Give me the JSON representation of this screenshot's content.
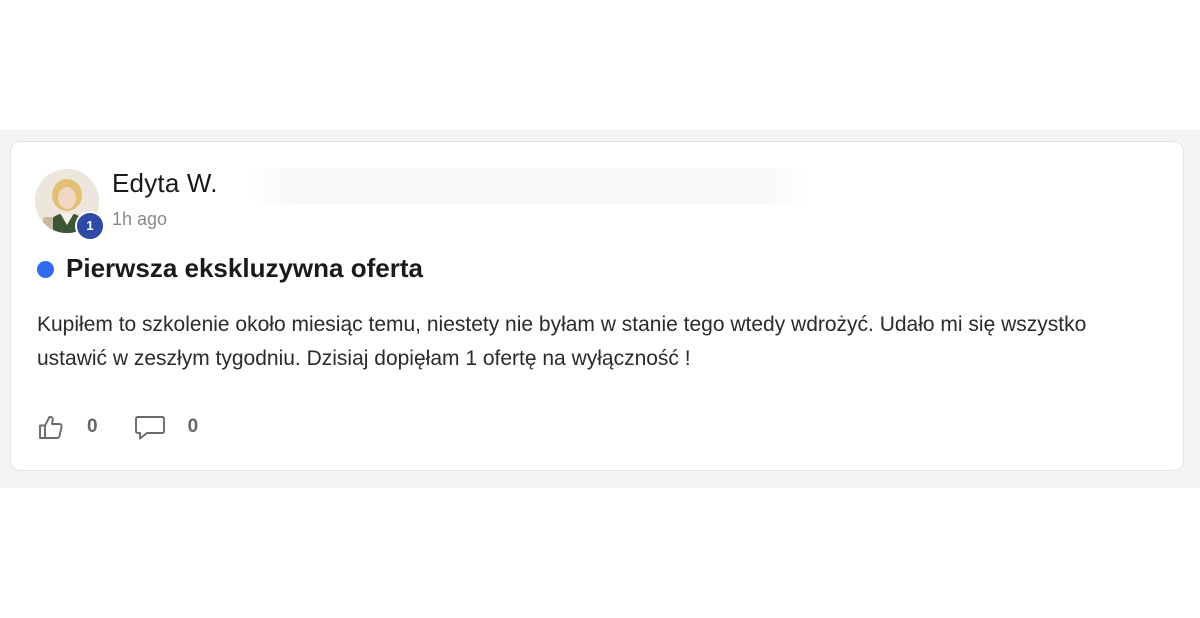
{
  "post": {
    "author": {
      "name": "Edyta W.",
      "level": "1",
      "avatar_icon": "user-photo"
    },
    "time": "1h ago",
    "title": "Pierwsza ekskluzywna oferta",
    "title_dot_color": "#2f6cf2",
    "body": "Kupiłem to szkolenie około miesiąc temu, niestety nie byłam w stanie tego wtedy wdrożyć. Udało mi się wszystko ustawić w zeszłym tygodniu. Dzisiaj dopięłam 1 ofertę na wyłączność !",
    "actions": {
      "likes": {
        "icon": "thumbs-up-icon",
        "count": "0"
      },
      "comments": {
        "icon": "comment-icon",
        "count": "0"
      }
    }
  },
  "colors": {
    "level_badge": "#2d4aa6",
    "page_band": "#f5f4f2"
  }
}
